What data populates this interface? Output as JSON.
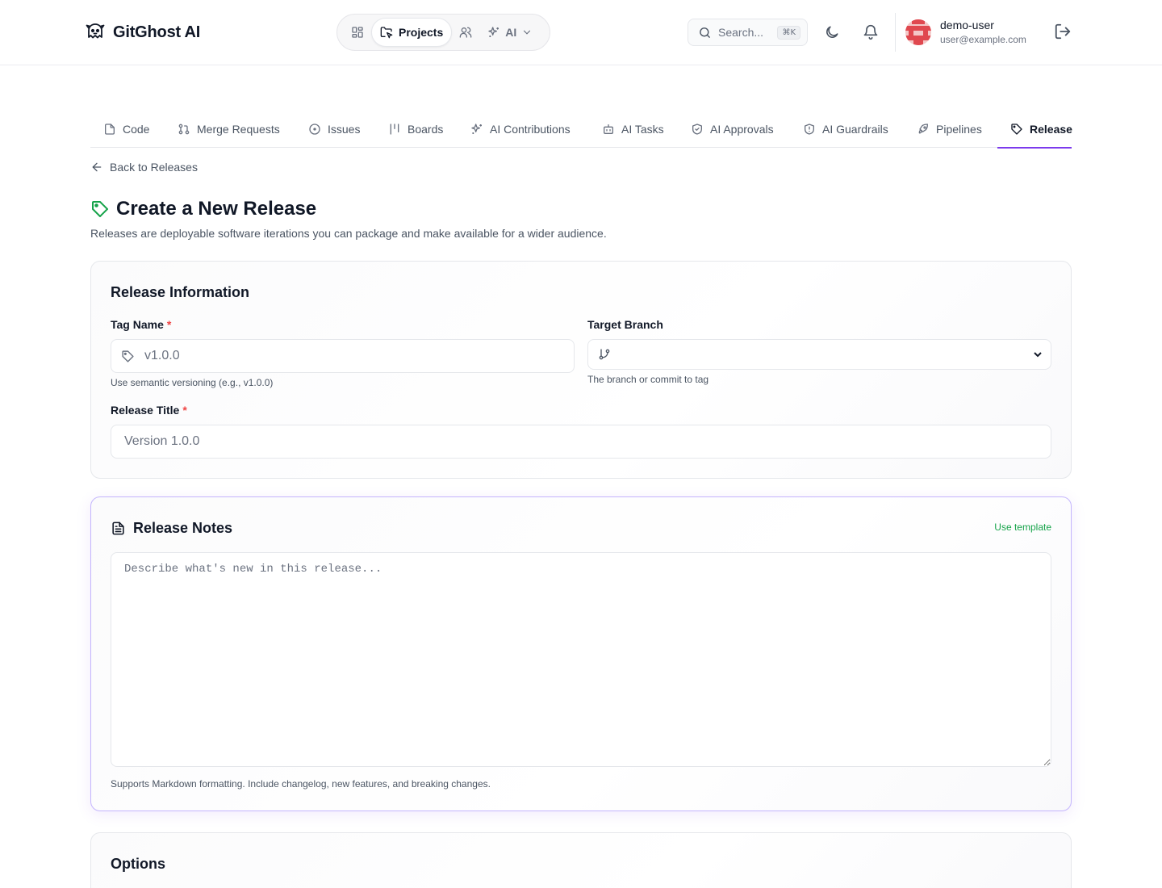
{
  "app": {
    "name": "GitGhost AI"
  },
  "nav": {
    "active_label": "Projects",
    "ai_label": "AI"
  },
  "search": {
    "placeholder": "Search...",
    "shortcut": "⌘K"
  },
  "user": {
    "name": "demo-user",
    "email": "user@example.com"
  },
  "tabs": [
    {
      "label": "Code",
      "icon": "file-icon"
    },
    {
      "label": "Merge Requests",
      "icon": "git-pull-request-icon"
    },
    {
      "label": "Issues",
      "icon": "circle-dot-icon"
    },
    {
      "label": "Boards",
      "icon": "kanban-icon"
    },
    {
      "label": "AI Contributions",
      "icon": "sparkles-icon"
    },
    {
      "label": "AI Tasks",
      "icon": "bot-icon"
    },
    {
      "label": "AI Approvals",
      "icon": "shield-check-icon"
    },
    {
      "label": "AI Guardrails",
      "icon": "shield-alert-icon"
    },
    {
      "label": "Pipelines",
      "icon": "rocket-icon"
    },
    {
      "label": "Release",
      "icon": "tag-icon",
      "active": true
    }
  ],
  "back_link": "Back to Releases",
  "page": {
    "title": "Create a New Release",
    "subtitle": "Releases are deployable software iterations you can package and make available for a wider audience."
  },
  "release_info": {
    "heading": "Release Information",
    "tag_name": {
      "label": "Tag Name",
      "required_mark": "*",
      "placeholder": "v1.0.0",
      "value": "",
      "hint": "Use semantic versioning (e.g., v1.0.0)"
    },
    "target_branch": {
      "label": "Target Branch",
      "value": "",
      "hint": "The branch or commit to tag"
    },
    "release_title": {
      "label": "Release Title",
      "required_mark": "*",
      "placeholder": "Version 1.0.0",
      "value": ""
    }
  },
  "release_notes": {
    "heading": "Release Notes",
    "template_link": "Use template",
    "placeholder": "Describe what's new in this release...",
    "hint": "Supports Markdown formatting. Include changelog, new features, and breaking changes."
  },
  "options": {
    "heading": "Options"
  },
  "colors": {
    "accent": "#7c3aed",
    "success": "#16a34a",
    "required": "#ef4444"
  }
}
